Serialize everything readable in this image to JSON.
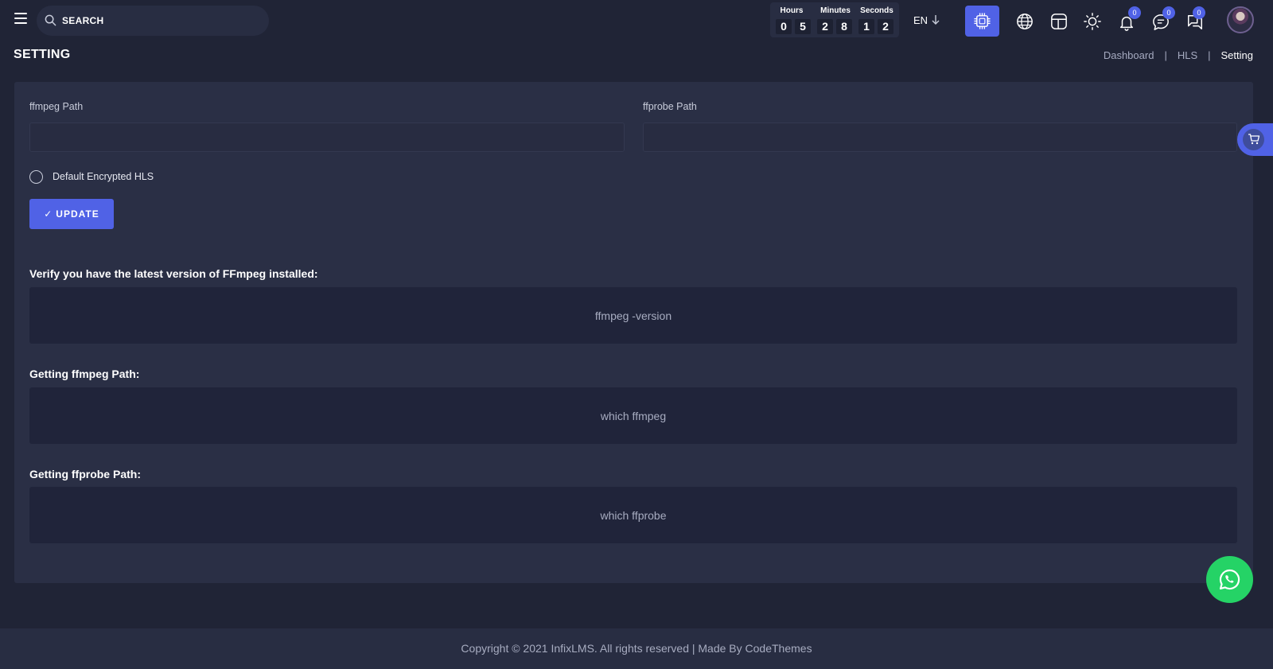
{
  "header": {
    "search_placeholder": "SEARCH",
    "countdown": {
      "hours_label": "Hours",
      "minutes_label": "Minutes",
      "seconds_label": "Seconds",
      "hours": [
        "0",
        "5"
      ],
      "minutes": [
        "2",
        "8"
      ],
      "seconds": [
        "1",
        "2"
      ]
    },
    "language": "EN",
    "notifications_count": "0",
    "messages_count": "0",
    "chats_count": "0"
  },
  "page": {
    "title": "SETTING",
    "breadcrumb": [
      "Dashboard",
      "HLS",
      "Setting"
    ]
  },
  "form": {
    "ffmpeg_label": "ffmpeg Path",
    "ffmpeg_value": "",
    "ffprobe_label": "ffprobe Path",
    "ffprobe_value": "",
    "encrypted_label": "Default Encrypted HLS",
    "encrypted_checked": false,
    "update_label": "UPDATE"
  },
  "instructions": [
    {
      "title": "Verify you have the latest version of FFmpeg installed:",
      "command": "ffmpeg -version"
    },
    {
      "title": "Getting ffmpeg Path:",
      "command": "which ffmpeg"
    },
    {
      "title": "Getting ffprobe Path:",
      "command": "which ffprobe"
    }
  ],
  "footer": {
    "text": "Copyright © 2021 InfixLMS. All rights reserved | Made By CodeThemes"
  },
  "colors": {
    "accent": "#5062e6",
    "background": "#202436",
    "card": "#2a2f45",
    "whatsapp": "#25d366"
  }
}
